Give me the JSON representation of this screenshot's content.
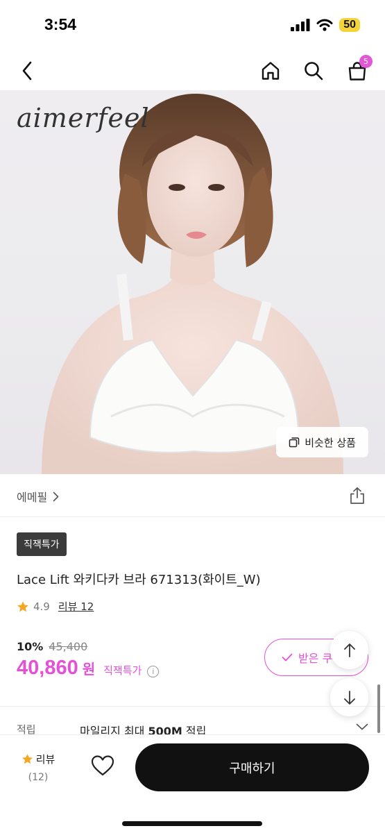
{
  "status_bar": {
    "time": "3:54",
    "battery": "50"
  },
  "nav": {
    "cart_count": "5"
  },
  "hero": {
    "brand_logo": "aimerfeel",
    "similar_button": "비슷한 상품"
  },
  "brand": {
    "name": "에메필"
  },
  "product": {
    "tag": "직잭특가",
    "title": "Lace Lift 와키다카 브라 671313(화이트_W)",
    "rating": "4.9",
    "review_label": "리뷰 12",
    "discount": "10%",
    "original_price": "45,400",
    "price": "40,860",
    "price_unit": "원",
    "price_tag": "직잭특가",
    "coupon_label": "받은 쿠"
  },
  "mileage": {
    "label": "적립",
    "text_prefix": "마일리지 최대 ",
    "amount": "500M",
    "text_suffix": " 적립"
  },
  "bottom_bar": {
    "review_label": "리뷰",
    "review_count": "(12)",
    "buy_label": "구매하기"
  },
  "colors": {
    "accent": "#e64fd7",
    "badge": "#e356d6",
    "star": "#f5a623",
    "battery": "#f5d33a"
  }
}
